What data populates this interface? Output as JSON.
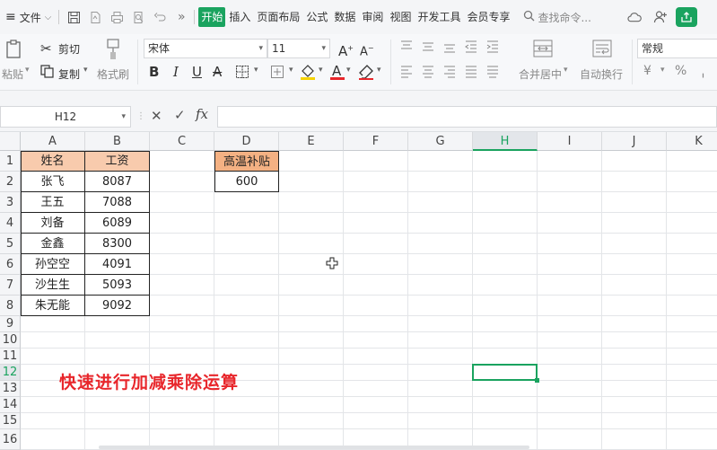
{
  "menubar": {
    "file_label": "文件",
    "tabs": [
      {
        "label": "开始",
        "active": true
      },
      {
        "label": "插入"
      },
      {
        "label": "页面布局"
      },
      {
        "label": "公式"
      },
      {
        "label": "数据"
      },
      {
        "label": "审阅"
      },
      {
        "label": "视图"
      },
      {
        "label": "开发工具"
      },
      {
        "label": "会员专享"
      }
    ],
    "search_placeholder": "查找命令..."
  },
  "ribbon": {
    "cut_label": "剪切",
    "paste_label": "粘贴",
    "copy_label": "复制",
    "format_painter_label": "格式刷",
    "font_name": "宋体",
    "font_size": "11",
    "merge_label": "合并居中",
    "wrap_label": "自动换行",
    "number_format": "常规"
  },
  "formula_bar": {
    "name_box": "H12",
    "fx_label": "fx",
    "content": ""
  },
  "grid": {
    "columns": [
      "A",
      "B",
      "C",
      "D",
      "E",
      "F",
      "G",
      "H",
      "I",
      "J",
      "K"
    ],
    "rows": [
      "1",
      "2",
      "3",
      "4",
      "5",
      "6",
      "7",
      "8",
      "9",
      "10",
      "11",
      "12",
      "13",
      "14",
      "15",
      "16"
    ],
    "selected_cell": "H12",
    "table": {
      "header": [
        "姓名",
        "工资"
      ],
      "rows": [
        [
          "张飞",
          "8087"
        ],
        [
          "王五",
          "7088"
        ],
        [
          "刘备",
          "6089"
        ],
        [
          "金鑫",
          "8300"
        ],
        [
          "孙空空",
          "4091"
        ],
        [
          "沙生生",
          "5093"
        ],
        [
          "朱无能",
          "9092"
        ]
      ]
    },
    "bonus": {
      "header": "高温补贴",
      "value": "600"
    },
    "caption": "快速进行加减乘除运算"
  },
  "colors": {
    "accent": "#1aa35f",
    "header_fill": "#f4b183",
    "caption": "#e8262b"
  }
}
